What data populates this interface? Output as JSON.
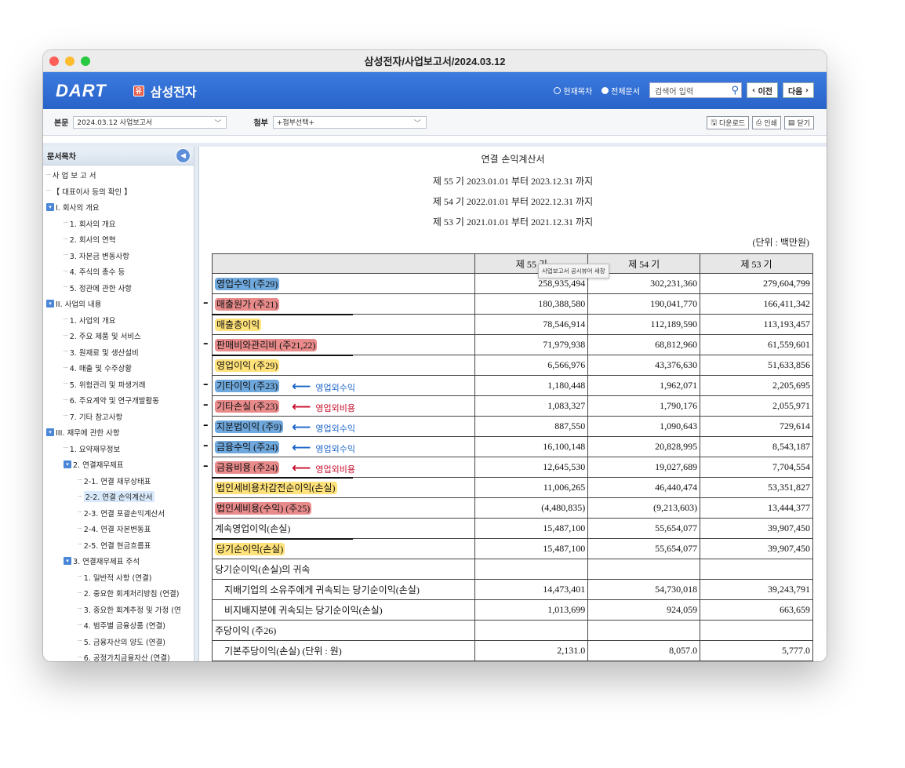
{
  "window": {
    "title": "삼성전자/사업보고서/2024.03.12"
  },
  "header": {
    "logo": "DART",
    "company_badge": "유",
    "company": "삼성전자",
    "radio_current": "현재목차",
    "radio_all": "전체문서",
    "search_placeholder": "검색어 입력",
    "prev_label": "이전",
    "next_label": "다음"
  },
  "toolbar": {
    "main_label": "본문",
    "main_select": "2024.03.12  사업보고서",
    "attach_label": "첨부",
    "attach_select": "+첨부선택+",
    "download": "다운로드",
    "print": "인쇄",
    "close": "닫기"
  },
  "sidebar": {
    "title": "문서목차",
    "items": [
      {
        "label": "사 업 보 고 서",
        "level": 0,
        "exp": false
      },
      {
        "label": "【 대표이사 등의 확인 】",
        "level": 0,
        "exp": false
      },
      {
        "label": "I. 회사의 개요",
        "level": 0,
        "exp": true
      },
      {
        "label": "1. 회사의 개요",
        "level": 1,
        "exp": false
      },
      {
        "label": "2. 회사의 연혁",
        "level": 1,
        "exp": false
      },
      {
        "label": "3. 자본금 변동사항",
        "level": 1,
        "exp": false
      },
      {
        "label": "4. 주식의 총수 등",
        "level": 1,
        "exp": false
      },
      {
        "label": "5. 정관에 관한 사항",
        "level": 1,
        "exp": false
      },
      {
        "label": "II. 사업의 내용",
        "level": 0,
        "exp": true
      },
      {
        "label": "1. 사업의 개요",
        "level": 1,
        "exp": false
      },
      {
        "label": "2. 주요 제품 및 서비스",
        "level": 1,
        "exp": false
      },
      {
        "label": "3. 원재료 및 생산설비",
        "level": 1,
        "exp": false
      },
      {
        "label": "4. 매출 및 수주상황",
        "level": 1,
        "exp": false
      },
      {
        "label": "5. 위험관리 및 파생거래",
        "level": 1,
        "exp": false
      },
      {
        "label": "6. 주요계약 및 연구개발활동",
        "level": 1,
        "exp": false
      },
      {
        "label": "7. 기타 참고사항",
        "level": 1,
        "exp": false
      },
      {
        "label": "III. 재무에 관한 사항",
        "level": 0,
        "exp": true
      },
      {
        "label": "1. 요약재무정보",
        "level": 1,
        "exp": false
      },
      {
        "label": "2. 연결재무제표",
        "level": 1,
        "exp": true
      },
      {
        "label": "2-1. 연결 재무상태표",
        "level": 2,
        "exp": false
      },
      {
        "label": "2-2. 연결 손익계산서",
        "level": 2,
        "exp": false,
        "selected": true
      },
      {
        "label": "2-3. 연결 포괄손익계산서",
        "level": 2,
        "exp": false
      },
      {
        "label": "2-4. 연결 자본변동표",
        "level": 2,
        "exp": false
      },
      {
        "label": "2-5. 연결 현금흐름표",
        "level": 2,
        "exp": false
      },
      {
        "label": "3. 연결재무제표 주석",
        "level": 1,
        "exp": true
      },
      {
        "label": "1. 일반적 사항 (연결)",
        "level": 2,
        "exp": false
      },
      {
        "label": "2. 중요한 회계처리방침 (연결)",
        "level": 2,
        "exp": false
      },
      {
        "label": "3. 중요한 회계추정 및 가정 (연",
        "level": 2,
        "exp": false
      },
      {
        "label": "4. 범주별 금융상품 (연결)",
        "level": 2,
        "exp": false
      },
      {
        "label": "5. 금융자산의 양도 (연결)",
        "level": 2,
        "exp": false
      },
      {
        "label": "6. 공정가치금융자산 (연결)",
        "level": 2,
        "exp": false
      }
    ]
  },
  "doc": {
    "title": "연결 손익계산서",
    "periods": [
      "제 55 기 2023.01.01 부터 2023.12.31 까지",
      "제 54 기 2022.01.01 부터 2022.12.31 까지",
      "제 53 기 2021.01.01 부터 2021.12.31 까지"
    ],
    "unit": "(단위 : 백만원)",
    "columns": [
      "",
      "제 55 기",
      "제 54 기",
      "제 53 기"
    ],
    "tooltip": "사업보고서 공시뷰어 새창",
    "rows": [
      {
        "label": "영업수익 (주29)",
        "hl": "blue",
        "v": [
          "258,935,494",
          "302,231,360",
          "279,604,799"
        ]
      },
      {
        "label": "매출원가 (주21)",
        "hl": "red",
        "v": [
          "180,388,580",
          "190,041,770",
          "166,411,342"
        ]
      },
      {
        "label": "매출총이익",
        "hl": "yellow",
        "v": [
          "78,546,914",
          "112,189,590",
          "113,193,457"
        ]
      },
      {
        "label": "판매비와관리비 (주21,22)",
        "hl": "red",
        "v": [
          "71,979,938",
          "68,812,960",
          "61,559,601"
        ]
      },
      {
        "label": "영업이익 (주29)",
        "hl": "yellow",
        "v": [
          "6,566,976",
          "43,376,630",
          "51,633,856"
        ]
      },
      {
        "label": "기타이익 (주23)",
        "hl": "blue",
        "v": [
          "1,180,448",
          "1,962,071",
          "2,205,695"
        ]
      },
      {
        "label": "기타손실 (주23)",
        "hl": "red",
        "v": [
          "1,083,327",
          "1,790,176",
          "2,055,971"
        ]
      },
      {
        "label": "지분법이익 (주9)",
        "hl": "blue",
        "v": [
          "887,550",
          "1,090,643",
          "729,614"
        ]
      },
      {
        "label": "금융수익 (주24)",
        "hl": "blue",
        "v": [
          "16,100,148",
          "20,828,995",
          "8,543,187"
        ]
      },
      {
        "label": "금융비용 (주24)",
        "hl": "red",
        "v": [
          "12,645,530",
          "19,027,689",
          "7,704,554"
        ]
      },
      {
        "label": "법인세비용차감전순이익(손실)",
        "hl": "yellow",
        "v": [
          "11,006,265",
          "46,440,474",
          "53,351,827"
        ]
      },
      {
        "label": "법인세비용(수익) (주25)",
        "hl": "red",
        "v": [
          "(4,480,835)",
          "(9,213,603)",
          "13,444,377"
        ]
      },
      {
        "label": "계속영업이익(손실)",
        "hl": "",
        "v": [
          "15,487,100",
          "55,654,077",
          "39,907,450"
        ]
      },
      {
        "label": "당기순이익(손실)",
        "hl": "yellow",
        "v": [
          "15,487,100",
          "55,654,077",
          "39,907,450"
        ]
      },
      {
        "label": "당기순이익(손실)의 귀속",
        "hl": "",
        "v": [
          "",
          "",
          ""
        ]
      },
      {
        "label": "지배기업의 소유주에게 귀속되는 당기순이익(손실)",
        "hl": "",
        "indent": true,
        "v": [
          "14,473,401",
          "54,730,018",
          "39,243,791"
        ]
      },
      {
        "label": "비지배지분에 귀속되는 당기순이익(손실)",
        "hl": "",
        "indent": true,
        "v": [
          "1,013,699",
          "924,059",
          "663,659"
        ]
      },
      {
        "label": "주당이익 (주26)",
        "hl": "",
        "v": [
          "",
          "",
          ""
        ]
      },
      {
        "label": "기본주당이익(손실) (단위 : 원)",
        "hl": "",
        "indent": true,
        "v": [
          "2,131.0",
          "8,057.0",
          "5,777.0"
        ]
      }
    ],
    "annotations": [
      {
        "row": 5,
        "text": "영업외수익",
        "color": "blue"
      },
      {
        "row": 6,
        "text": "영업외비용",
        "color": "red"
      },
      {
        "row": 7,
        "text": "영업외수익",
        "color": "blue"
      },
      {
        "row": 8,
        "text": "영업외수익",
        "color": "blue"
      },
      {
        "row": 9,
        "text": "영업외비용",
        "color": "red"
      }
    ]
  }
}
